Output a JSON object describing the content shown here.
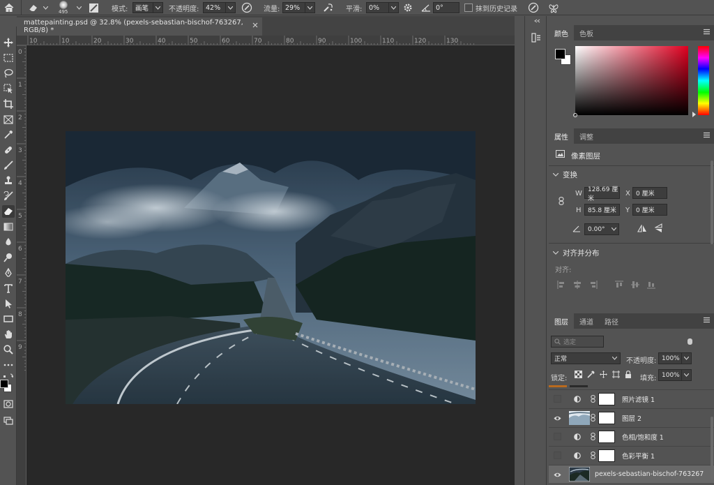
{
  "options_bar": {
    "brush_size": "495",
    "mode_label": "模式:",
    "mode_value": "画笔",
    "opacity_label": "不透明度:",
    "opacity_value": "42%",
    "flow_label": "流量:",
    "flow_value": "29%",
    "smooth_label": "平滑:",
    "smooth_value": "0%",
    "angle_value": "0°",
    "erase_history_label": "抹到历史记录"
  },
  "document": {
    "tab_title": "mattepainting.psd @ 32.8% (pexels-sebastian-bischof-763267, RGB/8) *",
    "ruler_h": [
      "10",
      "10",
      "20",
      "30",
      "40",
      "50",
      "60",
      "70",
      "80",
      "90",
      "100",
      "110",
      "120",
      "130"
    ],
    "ruler_v": [
      "0",
      "1",
      "2",
      "3",
      "4",
      "5",
      "6",
      "7",
      "8",
      "9"
    ]
  },
  "color_panel": {
    "tabs": [
      "颜色",
      "色板"
    ],
    "foreground": "#000000",
    "background": "#ffffff",
    "hue_color": "#e00020"
  },
  "properties_panel": {
    "tabs": [
      "属性",
      "调整"
    ],
    "type_label": "像素图层",
    "transform_title": "变换",
    "w_label": "W",
    "w_value": "128.69 厘米",
    "x_label": "X",
    "x_value": "0 厘米",
    "h_label": "H",
    "h_value": "85.8 厘米",
    "y_label": "Y",
    "y_value": "0 厘米",
    "angle_value": "0.00°",
    "align_title": "对齐并分布",
    "align_label": "对齐:"
  },
  "layers_panel": {
    "tabs": [
      "图层",
      "通道",
      "路径"
    ],
    "filter_placeholder": "选定",
    "blend_mode": "正常",
    "opacity_label": "不透明度:",
    "opacity_value": "100%",
    "lock_label": "锁定:",
    "fill_label": "填充:",
    "fill_value": "100%",
    "layers": [
      {
        "name": "照片滤镜 1",
        "visible": false,
        "kind": "adjustment"
      },
      {
        "name": "图层 2",
        "visible": true,
        "kind": "pixel-mask"
      },
      {
        "name": "色相/饱和度 1",
        "visible": false,
        "kind": "adjustment"
      },
      {
        "name": "色彩平衡 1",
        "visible": false,
        "kind": "adjustment"
      },
      {
        "name": "pexels-sebastian-bischof-763267",
        "visible": true,
        "kind": "pixel"
      }
    ]
  }
}
